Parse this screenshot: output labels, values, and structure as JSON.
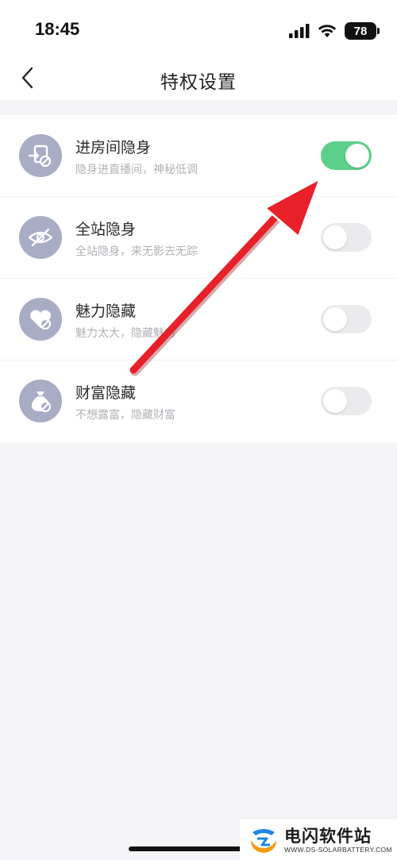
{
  "status_bar": {
    "time": "18:45",
    "battery": "78",
    "icons": [
      "signal-icon",
      "wifi-icon",
      "battery-icon"
    ]
  },
  "header": {
    "title": "特权设置",
    "back_icon": "chevron-left-icon"
  },
  "settings": [
    {
      "title": "进房间隐身",
      "description": "隐身进直播间，神秘低调",
      "enabled": true,
      "icon": "room-stealth-icon"
    },
    {
      "title": "全站隐身",
      "description": "全站隐身，来无影去无踪",
      "enabled": false,
      "icon": "eye-off-icon"
    },
    {
      "title": "魅力隐藏",
      "description": "魅力太大，隐藏魅力",
      "enabled": false,
      "icon": "heart-hidden-icon"
    },
    {
      "title": "财富隐藏",
      "description": "不想露富，隐藏财富",
      "enabled": false,
      "icon": "money-bag-hidden-icon"
    }
  ],
  "colors": {
    "toggle_on": "#5ccf8b",
    "toggle_off": "#ebebee",
    "icon_bg": "#a8acc4",
    "annotation": "#e8202a"
  },
  "watermark": {
    "name": "电闪软件站",
    "url": "WWW.DS-SOLARBATTERY.COM"
  }
}
